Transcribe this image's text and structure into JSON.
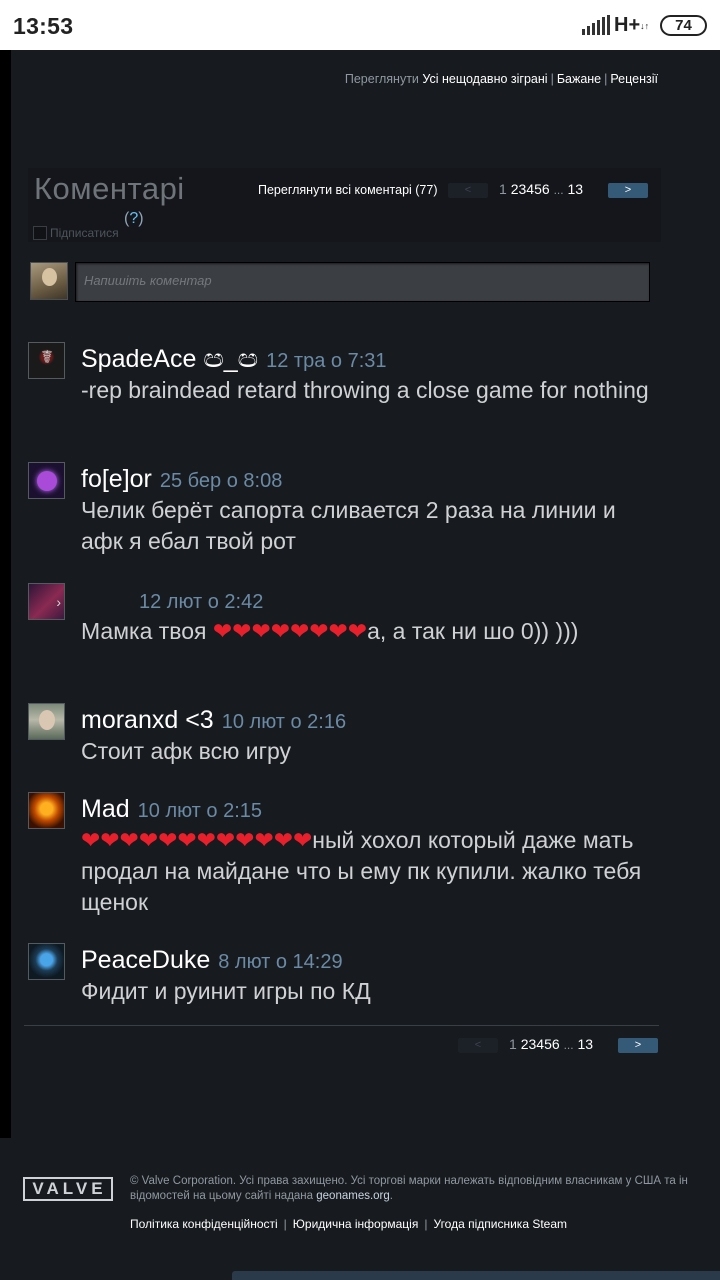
{
  "status_bar": {
    "time": "13:53",
    "network": "H+",
    "network_sub": "↓↑",
    "battery": "74"
  },
  "header": {
    "browse_prefix": "Переглянути",
    "links": [
      "Усі нещодавно зіграні",
      "Бажане",
      "Рецензії"
    ]
  },
  "comments_section": {
    "title": "Коментарі",
    "help": "?",
    "subscribe_label": "Підписатися",
    "view_all": "Переглянути всі коментарі (77)",
    "input_placeholder": "Напишіть коментар",
    "pagination": {
      "prev": "<",
      "next": ">",
      "pages": [
        "1",
        "2",
        "3",
        "4",
        "5",
        "6"
      ],
      "dots": "...",
      "last": "13",
      "current": "1"
    }
  },
  "comments": [
    {
      "author": "SpadeAce ඏ_ඏ",
      "date": "12 тра о 7:31",
      "text": "-rep braindead retard throwing a close game for nothing"
    },
    {
      "author": "fo[e]or",
      "date": "25 бер о 8:08",
      "text": "Челик берёт сапорта сливается 2 раза на линии и афк я ебал твой рот"
    },
    {
      "author": "",
      "date": "12 лют о 2:42",
      "text_before": "Мамка твоя ",
      "hearts": "❤❤❤❤❤❤❤❤",
      "text_after": "а, а так ни шо 0)) )))"
    },
    {
      "author": "moranxd <3",
      "date": "10 лют о 2:16",
      "text": "Стоит афк всю игру"
    },
    {
      "author": "Mad",
      "date": "10 лют о 2:15",
      "hearts": "❤❤❤❤❤❤❤❤❤❤❤❤",
      "text_after": "ный хохол который даже мать продал на майдане что ы ему пк купили. жалко тебя щенок"
    },
    {
      "author": "PeaceDuke",
      "date": "8 лют о 14:29",
      "text": "Фидит и руинит игры по КД"
    }
  ],
  "footer": {
    "logo": "VALVE",
    "copyright_line1": "© Valve Corporation. Усі права захищено. Усі торгові марки належать відповідним власникам у США та ін",
    "copyright_line2": "відомостей на цьому сайті надана ",
    "geonames": "geonames.org",
    "geonames_suffix": ".",
    "links": [
      "Політика конфіденційності",
      "Юридична інформація",
      "Угода підписника Steam"
    ]
  },
  "colors": {
    "panel": "#171a1f",
    "date": "#6b8aa5",
    "link_accent": "#66c0f4",
    "next_button": "#355a77",
    "heart": "#e8202c"
  }
}
